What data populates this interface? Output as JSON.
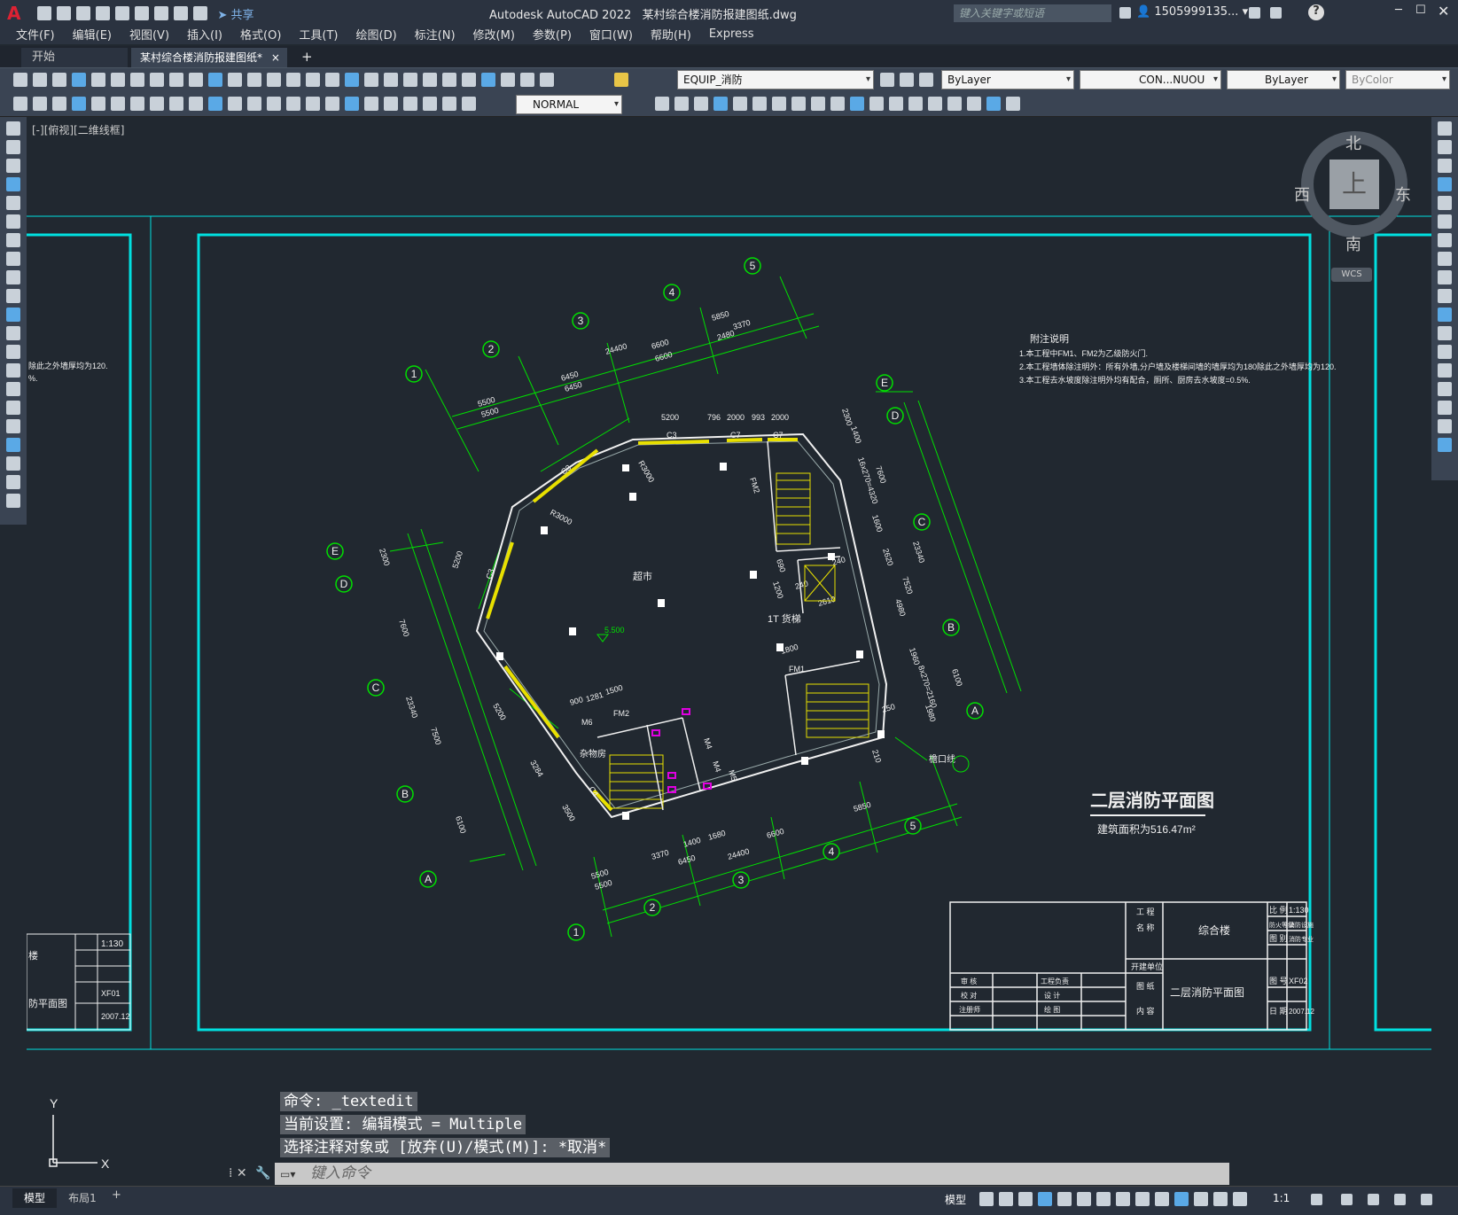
{
  "app": {
    "logo": "A",
    "title": "Autodesk AutoCAD 2022",
    "filename": "某村综合楼消防报建图纸.dwg",
    "share": "共享",
    "search_placeholder": "键入关键字或短语",
    "user": "1505999135...",
    "help": "?"
  },
  "menu": [
    "文件(F)",
    "编辑(E)",
    "视图(V)",
    "插入(I)",
    "格式(O)",
    "工具(T)",
    "绘图(D)",
    "标注(N)",
    "修改(M)",
    "参数(P)",
    "窗口(W)",
    "帮助(H)",
    "Express"
  ],
  "tabs": {
    "start": "开始",
    "doc": "某村综合楼消防报建图纸*",
    "close": "×",
    "add": "+"
  },
  "props": {
    "layer": "EQUIP_消防",
    "color": "ByLayer",
    "linetype": "CON...NUOU",
    "lineweight": "ByLayer",
    "plotstyle": "ByColor"
  },
  "style": {
    "textstyle": "NORMAL"
  },
  "viewport": {
    "label": "[-][俯视][二维线框]"
  },
  "compass": {
    "n": "北",
    "s": "南",
    "e": "东",
    "w": "西",
    "top": "上",
    "wcs": "WCS"
  },
  "drawing": {
    "title": "二层消防平面图",
    "area": "建筑面积为516.47m²",
    "notes_title": "附注说明",
    "notes": [
      "1.本工程中FM1、FM2为乙级防火门.",
      "2.本工程墙体除注明外：所有外墙,分户墙及楼梯间墙的墙厚均为180除此之外墙厚均为120.",
      "3.本工程去水坡度除注明外均有配合，厕所、厨房去水坡度=0.5%."
    ],
    "room": "超市",
    "elev": "5.500",
    "elevator": "1T 货梯",
    "gutter": "檐口线",
    "storage": "杂物房",
    "side_note_1": "除此之外墙厚均为120.",
    "side_note_2": "%.",
    "axes_top": [
      "1",
      "2",
      "3",
      "4",
      "5"
    ],
    "axes_side": [
      "A",
      "B",
      "C",
      "D",
      "E"
    ],
    "dims_top": [
      "5500",
      "5500",
      "6450",
      "6450",
      "24400",
      "6600",
      "6600",
      "2480",
      "5850",
      "3370"
    ],
    "dims_right": [
      "2300",
      "1400",
      "16x270=4320",
      "1600",
      "2620",
      "7600",
      "4980",
      "23340",
      "7520",
      "1960",
      "8x270=2160",
      "1980",
      "6100",
      "250",
      "240",
      "210"
    ],
    "dims_left": [
      "2300",
      "7600",
      "23340",
      "7500",
      "6100",
      "5200",
      "5200"
    ],
    "dims_bottom": [
      "5500",
      "5500",
      "6450",
      "3370",
      "1400",
      "1680",
      "24400",
      "6600",
      "5850"
    ],
    "dims_inner": [
      "5200",
      "796",
      "2000",
      "993",
      "2000",
      "R3000",
      "R3000",
      "900",
      "1281",
      "1500",
      "1800",
      "690",
      "1200",
      "240",
      "2610",
      "3284",
      "3500"
    ],
    "doors": [
      "C3",
      "C7",
      "C7",
      "C3",
      "C3",
      "C4",
      "FM2",
      "FM2",
      "FM1",
      "M6",
      "M4",
      "M4",
      "M5"
    ],
    "tb_right": {
      "project_lbl": "工 程",
      "name_lbl": "名 称",
      "unit_lbl": "开建单位",
      "project": "综合楼",
      "scale_lbl": "比 例",
      "scale": "1:130",
      "fire_lbl": "防火等级",
      "fire_val": "消防设施",
      "type_lbl": "图 别",
      "type": "消防专业",
      "draw_lbl": "图 纸",
      "content_lbl": "内 容",
      "drawing_name": "二层消防平面图",
      "num_lbl": "图 号",
      "num": "XF02",
      "date_lbl": "日 期",
      "date": "2007.12",
      "review": "审 核",
      "manager": "工程负责",
      "check": "校 对",
      "design": "设 计",
      "drafter": "注册师",
      "plot": "绘 图"
    },
    "tb_left": {
      "name": "楼",
      "scale": "1:130",
      "num": "XF01",
      "date": "2007.12",
      "drawing": "防平面图"
    }
  },
  "command": {
    "line1": "命令: _textedit",
    "line2": "当前设置: 编辑模式 = Multiple",
    "line3": "选择注释对象或 [放弃(U)/模式(M)]: *取消*",
    "input_placeholder": "键入命令"
  },
  "ucs": {
    "x": "X",
    "y": "Y"
  },
  "status": {
    "model_tab": "模型",
    "layout_tab": "布局1",
    "add": "+",
    "mode": "模型",
    "scale": "1:1"
  }
}
